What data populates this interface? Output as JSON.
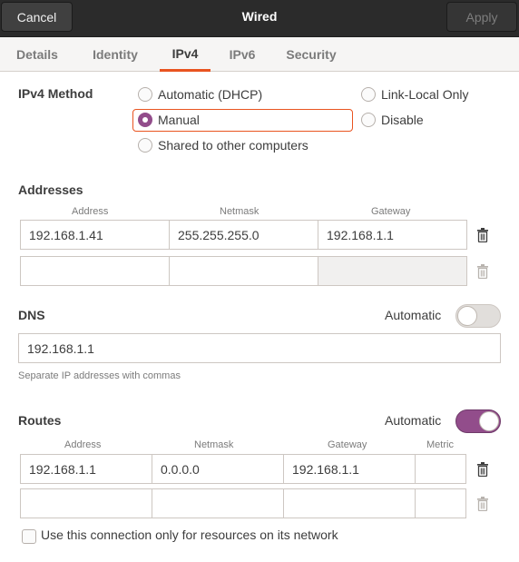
{
  "header": {
    "title": "Wired",
    "cancel_label": "Cancel",
    "apply_label": "Apply"
  },
  "tabs": {
    "details": "Details",
    "identity": "Identity",
    "ipv4": "IPv4",
    "ipv6": "IPv6",
    "security": "Security",
    "active": "IPv4"
  },
  "ipv4_method": {
    "label": "IPv4 Method",
    "options": {
      "automatic_dhcp": "Automatic (DHCP)",
      "link_local_only": "Link-Local Only",
      "manual": "Manual",
      "disable": "Disable",
      "shared": "Shared to other computers"
    },
    "selected": "Manual"
  },
  "addresses": {
    "title": "Addresses",
    "col_address": "Address",
    "col_netmask": "Netmask",
    "col_gateway": "Gateway",
    "rows": [
      {
        "address": "192.168.1.41",
        "netmask": "255.255.255.0",
        "gateway": "192.168.1.1"
      },
      {
        "address": "",
        "netmask": "",
        "gateway": ""
      }
    ]
  },
  "dns": {
    "title": "DNS",
    "automatic_label": "Automatic",
    "automatic_on": false,
    "value": "192.168.1.1",
    "hint": "Separate IP addresses with commas"
  },
  "routes": {
    "title": "Routes",
    "automatic_label": "Automatic",
    "automatic_on": true,
    "col_address": "Address",
    "col_netmask": "Netmask",
    "col_gateway": "Gateway",
    "col_metric": "Metric",
    "rows": [
      {
        "address": "192.168.1.1",
        "netmask": "0.0.0.0",
        "gateway": "192.168.1.1",
        "metric": ""
      },
      {
        "address": "",
        "netmask": "",
        "gateway": "",
        "metric": ""
      }
    ]
  },
  "only_local": {
    "label": "Use this connection only for resources on its network",
    "checked": false
  },
  "colors": {
    "accent_orange": "#e95420",
    "accent_purple": "#924d8b",
    "headerbar": "#2b2b2b"
  }
}
